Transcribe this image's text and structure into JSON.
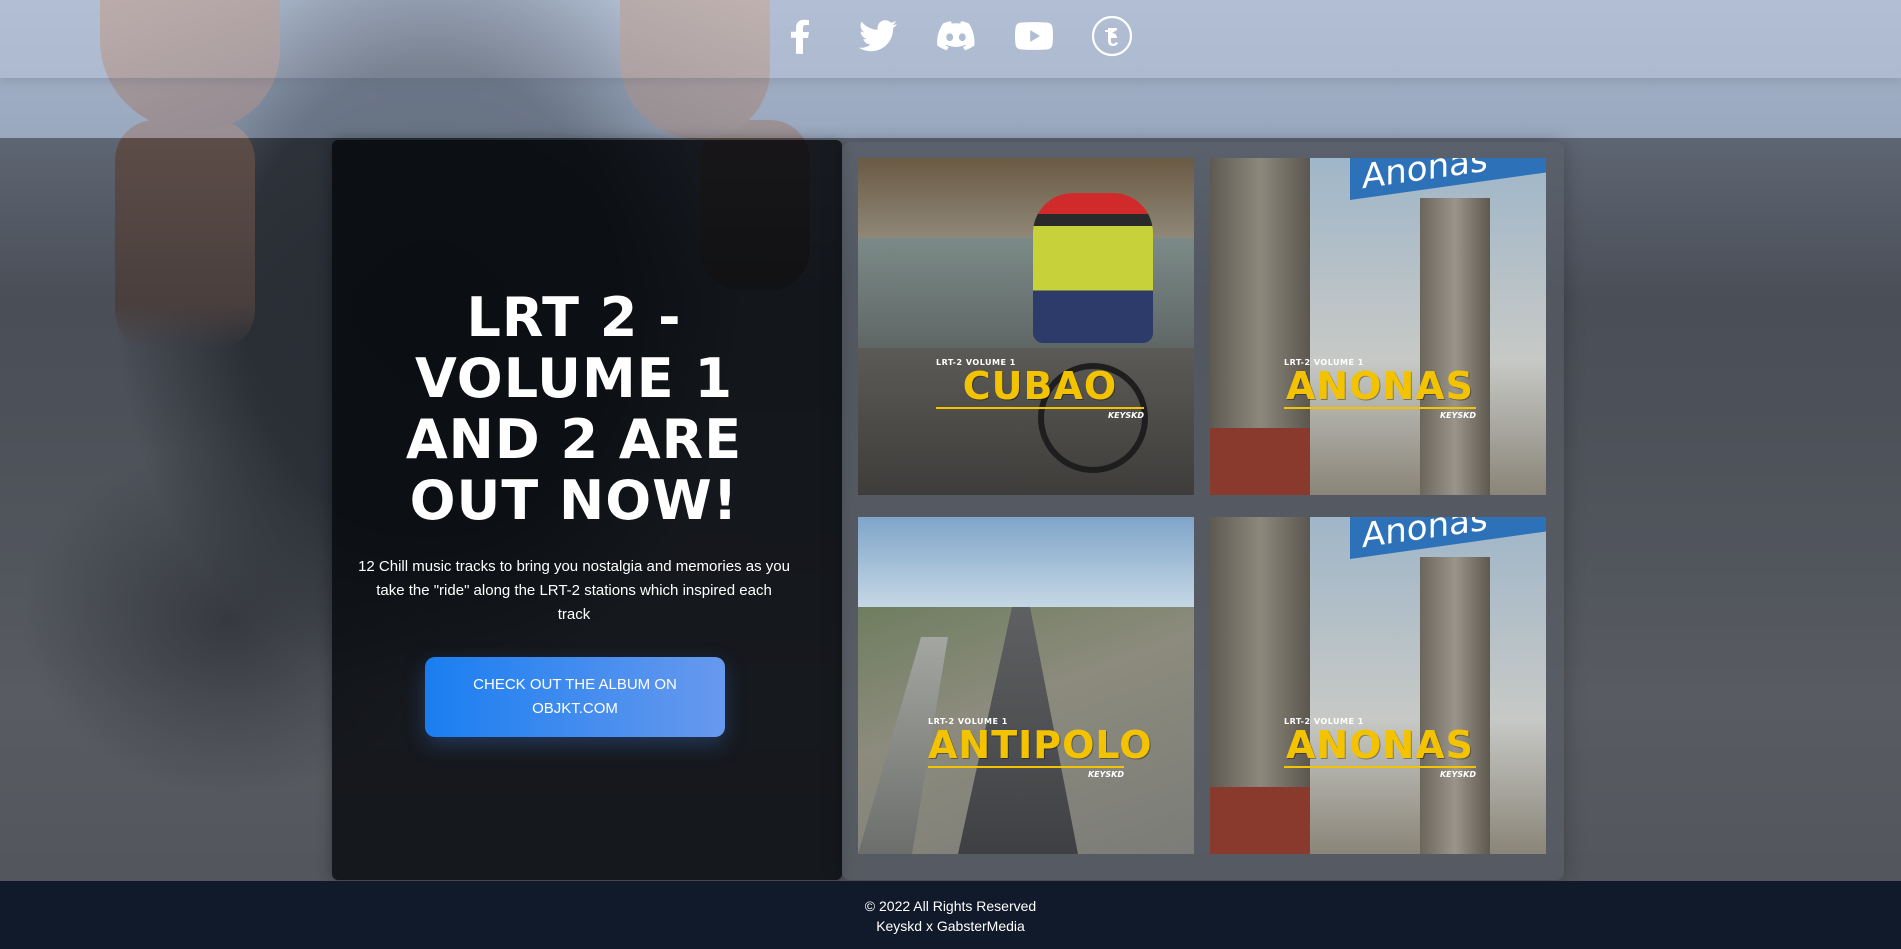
{
  "header": {
    "social_icons": [
      {
        "name": "facebook-icon"
      },
      {
        "name": "twitter-icon"
      },
      {
        "name": "discord-icon"
      },
      {
        "name": "youtube-icon"
      },
      {
        "name": "tezos-icon"
      }
    ]
  },
  "hero": {
    "headline": "LRT 2 - VOLUME 1 AND 2 ARE OUT NOW!",
    "description": "12 Chill music tracks to bring you nostalgia and memories as you take the \"ride\" along the LRT-2 stations which inspired each track",
    "cta_label": "CHECK OUT THE ALBUM ON OBJKT.COM"
  },
  "gallery": {
    "tiles": [
      {
        "series": "LRT-2 VOLUME 1",
        "station": "CUBAO",
        "artist": "KEYSKD"
      },
      {
        "series": "LRT-2 VOLUME 1",
        "station": "ANONAS",
        "artist": "KEYSKD",
        "sign": "Anonas"
      },
      {
        "series": "LRT-2 VOLUME 1",
        "station": "ANTIPOLO",
        "artist": "KEYSKD"
      },
      {
        "series": "LRT-2 VOLUME 1",
        "station": "ANONAS",
        "artist": "KEYSKD",
        "sign": "Anonas"
      }
    ]
  },
  "footer": {
    "copyright": "© 2022 All Rights Reserved",
    "credit": "Keyskd x GabsterMedia"
  },
  "colors": {
    "cta_start": "#1a7ef0",
    "cta_end": "#6899ee",
    "station_yellow": "#f4c300",
    "footer_bg": "#111a2a"
  }
}
